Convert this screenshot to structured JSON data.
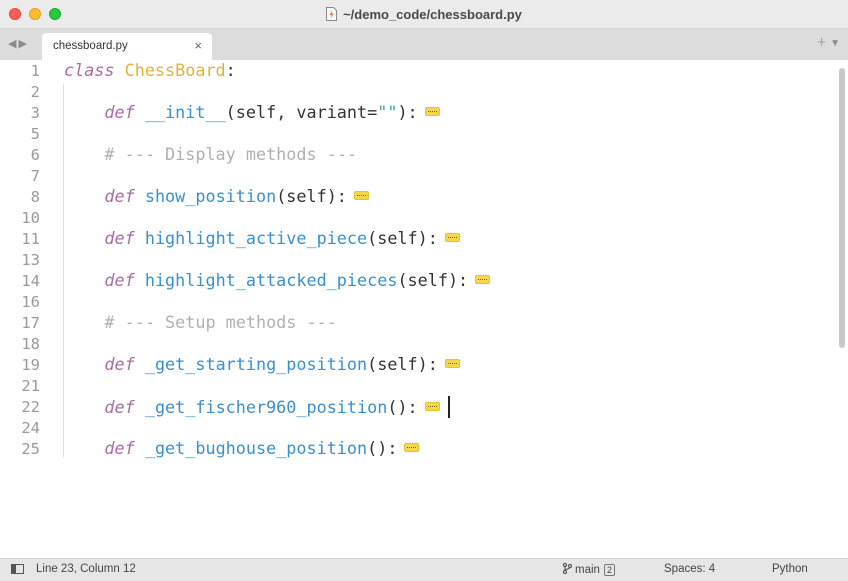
{
  "window": {
    "title": "~/demo_code/chessboard.py"
  },
  "tabs": [
    {
      "label": "chessboard.py",
      "close": "×"
    }
  ],
  "editor": {
    "lines": [
      {
        "num": "1",
        "tokens": [
          {
            "t": "class ",
            "c": "kw"
          },
          {
            "t": "ChessBoard",
            "c": "cls"
          },
          {
            "t": ":",
            "c": "pl"
          }
        ]
      },
      {
        "num": "2",
        "tokens": []
      },
      {
        "num": "3",
        "tokens": [
          {
            "t": "    ",
            "c": "pl"
          },
          {
            "t": "def ",
            "c": "kw"
          },
          {
            "t": "__init__",
            "c": "fn"
          },
          {
            "t": "(self, variant=",
            "c": "pl"
          },
          {
            "t": "\"\"",
            "c": "str"
          },
          {
            "t": "):",
            "c": "pl"
          }
        ],
        "fold": true
      },
      {
        "num": "5",
        "tokens": []
      },
      {
        "num": "6",
        "tokens": [
          {
            "t": "    ",
            "c": "pl"
          },
          {
            "t": "# --- Display methods ---",
            "c": "cmt"
          }
        ]
      },
      {
        "num": "7",
        "tokens": []
      },
      {
        "num": "8",
        "tokens": [
          {
            "t": "    ",
            "c": "pl"
          },
          {
            "t": "def ",
            "c": "kw"
          },
          {
            "t": "show_position",
            "c": "fn"
          },
          {
            "t": "(self):",
            "c": "pl"
          }
        ],
        "fold": true
      },
      {
        "num": "10",
        "tokens": []
      },
      {
        "num": "11",
        "tokens": [
          {
            "t": "    ",
            "c": "pl"
          },
          {
            "t": "def ",
            "c": "kw"
          },
          {
            "t": "highlight_active_piece",
            "c": "fn"
          },
          {
            "t": "(self):",
            "c": "pl"
          }
        ],
        "fold": true
      },
      {
        "num": "13",
        "tokens": []
      },
      {
        "num": "14",
        "tokens": [
          {
            "t": "    ",
            "c": "pl"
          },
          {
            "t": "def ",
            "c": "kw"
          },
          {
            "t": "highlight_attacked_pieces",
            "c": "fn"
          },
          {
            "t": "(self):",
            "c": "pl"
          }
        ],
        "fold": true
      },
      {
        "num": "16",
        "tokens": []
      },
      {
        "num": "17",
        "tokens": [
          {
            "t": "    ",
            "c": "pl"
          },
          {
            "t": "# --- Setup methods ---",
            "c": "cmt"
          }
        ]
      },
      {
        "num": "18",
        "tokens": []
      },
      {
        "num": "19",
        "tokens": [
          {
            "t": "    ",
            "c": "pl"
          },
          {
            "t": "def ",
            "c": "kw"
          },
          {
            "t": "_get_starting_position",
            "c": "fn"
          },
          {
            "t": "(self):",
            "c": "pl"
          }
        ],
        "fold": true
      },
      {
        "num": "21",
        "tokens": []
      },
      {
        "num": "22",
        "tokens": [
          {
            "t": "    ",
            "c": "pl"
          },
          {
            "t": "def ",
            "c": "kw"
          },
          {
            "t": "_get_fischer960_position",
            "c": "fn"
          },
          {
            "t": "():",
            "c": "pl"
          }
        ],
        "fold": true,
        "cursor": true
      },
      {
        "num": "24",
        "tokens": []
      },
      {
        "num": "25",
        "tokens": [
          {
            "t": "    ",
            "c": "pl"
          },
          {
            "t": "def ",
            "c": "kw"
          },
          {
            "t": "_get_bughouse_position",
            "c": "fn"
          },
          {
            "t": "():",
            "c": "pl"
          }
        ],
        "fold": true
      }
    ]
  },
  "status": {
    "position": "Line 23, Column 12",
    "branch": "main",
    "branch_badge": "2",
    "indent": "Spaces: 4",
    "language": "Python"
  },
  "colors": {
    "keyword": "#a66ea3",
    "class_name": "#e0b43a",
    "function": "#3a8fcf",
    "string": "#3ea6a5",
    "comment": "#b0b0b0"
  }
}
